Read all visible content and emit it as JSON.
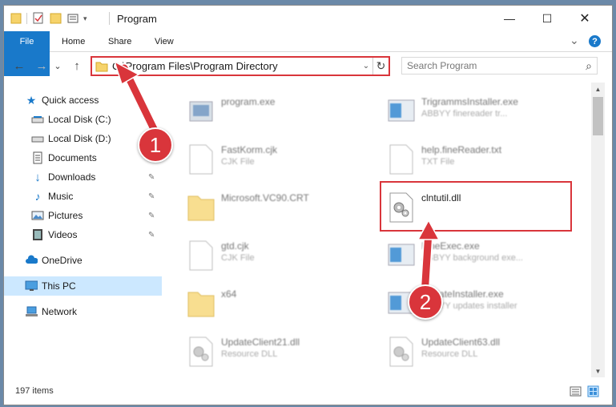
{
  "window": {
    "title": "Program",
    "minimize_glyph": "—",
    "maximize_glyph": "☐",
    "close_glyph": "✕"
  },
  "ribbon": {
    "tabs": [
      {
        "label": "File"
      },
      {
        "label": "Home"
      },
      {
        "label": "Share"
      },
      {
        "label": "View"
      }
    ],
    "expand_glyph": "⌄",
    "help_glyph": "?"
  },
  "nav": {
    "back_glyph": "←",
    "forward_glyph": "→",
    "recent_glyph": "⌄",
    "up_glyph": "↑",
    "address_path": "C:\\Program Files\\Program Directory",
    "address_dropdown_glyph": "⌄",
    "refresh_glyph": "↻",
    "search_placeholder": "Search Program",
    "search_glyph": "⌕"
  },
  "sidebar": {
    "items": [
      {
        "label": "Quick access",
        "icon": "star-icon"
      },
      {
        "label": "Local Disk (C:)",
        "icon": "drive-icon",
        "pinned": true
      },
      {
        "label": "Local Disk (D:)",
        "icon": "drive-icon"
      },
      {
        "label": "Documents",
        "icon": "documents-icon",
        "pinned": true
      },
      {
        "label": "Downloads",
        "icon": "download-icon",
        "pinned": true
      },
      {
        "label": "Music",
        "icon": "music-icon",
        "pinned": true
      },
      {
        "label": "Pictures",
        "icon": "pictures-icon",
        "pinned": true
      },
      {
        "label": "Videos",
        "icon": "videos-icon",
        "pinned": true
      },
      {
        "label": "OneDrive",
        "icon": "cloud-icon"
      },
      {
        "label": "This PC",
        "icon": "monitor-icon",
        "selected": true
      },
      {
        "label": "Network",
        "icon": "network-icon"
      }
    ],
    "pin_glyph": "📌"
  },
  "files": [
    {
      "name": "program.exe",
      "sub": "",
      "icon": "exe-icon"
    },
    {
      "name": "TrigrammsInstaller.exe",
      "sub": "ABBYY finereader tr...",
      "icon": "installer-icon"
    },
    {
      "name": "FastKorm.cjk",
      "sub": "CJK File",
      "icon": "file-icon"
    },
    {
      "name": "help.fineReader.txt",
      "sub": "TXT File",
      "icon": "file-icon"
    },
    {
      "name": "Microsoft.VC90.CRT",
      "sub": "",
      "icon": "folder-icon"
    },
    {
      "name": "clntutil.dll",
      "sub": "",
      "icon": "dll-gear-icon"
    },
    {
      "name": "gtd.cjk",
      "sub": "CJK File",
      "icon": "file-icon"
    },
    {
      "name": "FineExec.exe",
      "sub": "ABBYY background exe...",
      "icon": "installer-icon"
    },
    {
      "name": "x64",
      "sub": "",
      "icon": "folder-icon"
    },
    {
      "name": "UpdateInstaller.exe",
      "sub": "ABBYY updates installer",
      "icon": "installer-icon"
    },
    {
      "name": "UpdateClient21.dll",
      "sub": "Resource DLL",
      "icon": "dll-gear-icon"
    },
    {
      "name": "UpdateClient63.dll",
      "sub": "Resource DLL",
      "icon": "dll-gear-icon"
    }
  ],
  "status": {
    "item_count": "197 items"
  },
  "annotations": {
    "step1": "1",
    "step2": "2"
  },
  "colors": {
    "accent": "#1979ca",
    "annotation_red": "#d9353b",
    "selected_bg": "#cce8ff",
    "folder_yellow": "#f6d36b"
  }
}
